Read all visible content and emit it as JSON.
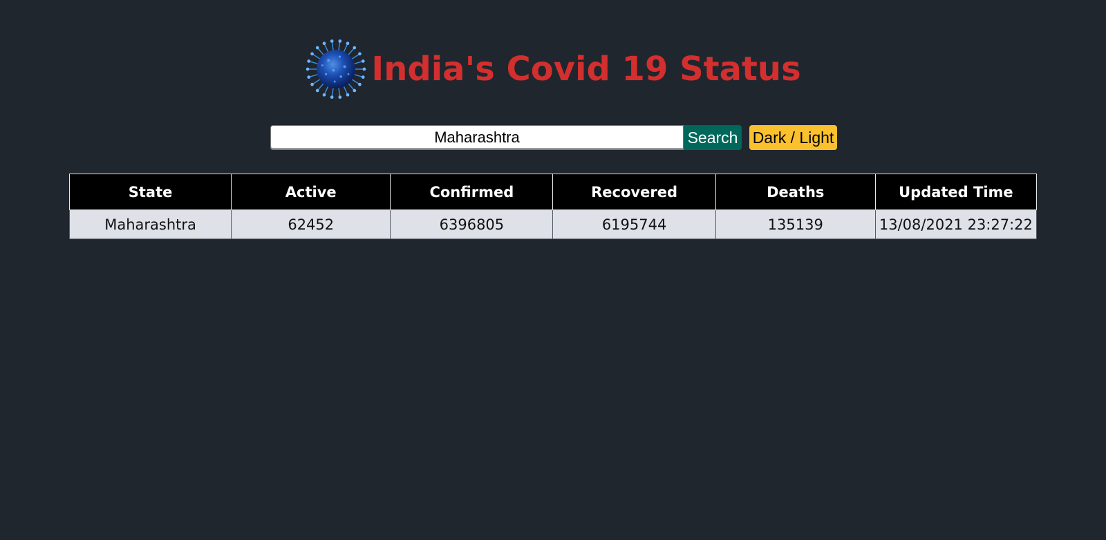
{
  "header": {
    "title": "India's Covid 19 Status",
    "icon": "virus-icon"
  },
  "search": {
    "value": "Maharashtra",
    "button_label": "Search",
    "toggle_label": "Dark / Light"
  },
  "table": {
    "columns": [
      "State",
      "Active",
      "Confirmed",
      "Recovered",
      "Deaths",
      "Updated Time"
    ],
    "rows": [
      [
        "Maharashtra",
        "62452",
        "6396805",
        "6195744",
        "135139",
        "13/08/2021 23:27:22"
      ]
    ]
  },
  "colors": {
    "background": "#20262e",
    "title": "#d32f2f",
    "search_button": "#00675b",
    "theme_button": "#fbc02d",
    "header_cell": "#000000",
    "body_cell": "#dee2e8"
  }
}
